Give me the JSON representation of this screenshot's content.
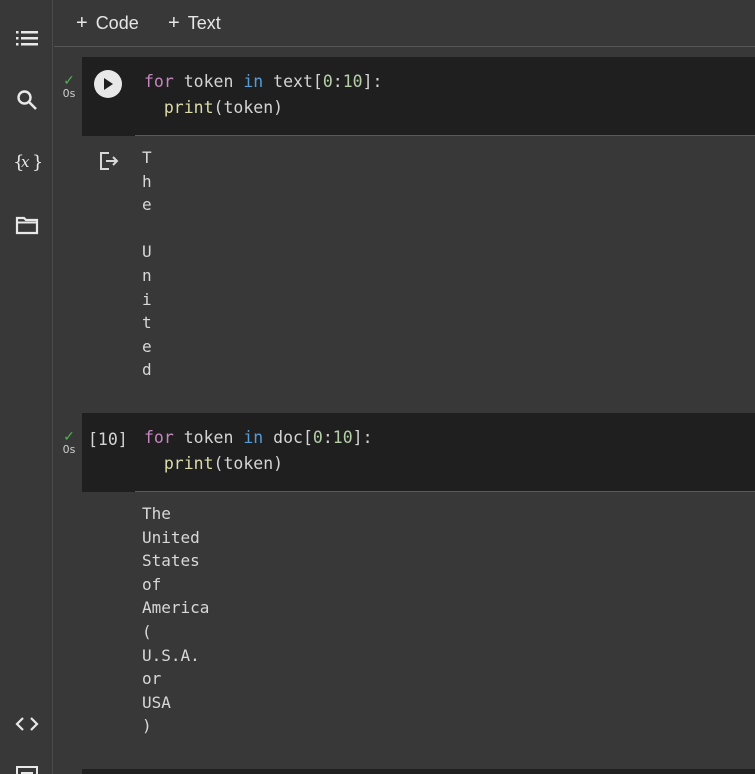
{
  "toolbar": {
    "add_code": "Code",
    "add_text": "Text"
  },
  "cells": [
    {
      "status_time": "0s",
      "line1": {
        "kw": "for",
        "var": "token",
        "in": "in",
        "obj": "text",
        "slice_start": "0",
        "slice_end": "10"
      },
      "line2": {
        "fn": "print",
        "arg": "token"
      },
      "output": [
        "T",
        "h",
        "e",
        " ",
        "U",
        "n",
        "i",
        "t",
        "e",
        "d"
      ]
    },
    {
      "status_time": "0s",
      "exec_count": "[10]",
      "line1": {
        "kw": "for",
        "var": "token",
        "in": "in",
        "obj": "doc",
        "slice_start": "0",
        "slice_end": "10"
      },
      "line2": {
        "fn": "print",
        "arg": "token"
      },
      "output": [
        "The",
        "United",
        "States",
        "of",
        "America",
        "(",
        "U.S.A.",
        "or",
        "USA",
        ")"
      ]
    }
  ],
  "icons": {
    "sidebar": [
      "toc-icon",
      "search-icon",
      "variables-icon",
      "folder-icon",
      "code-snippets-icon",
      "terminal-icon"
    ],
    "status": "check-icon",
    "run": "play-icon",
    "output": "output-redirect-icon"
  },
  "colors": {
    "keyword": "#c586c0",
    "function": "#dcdcaa",
    "number": "#b5cea8",
    "success": "#4caf50"
  }
}
